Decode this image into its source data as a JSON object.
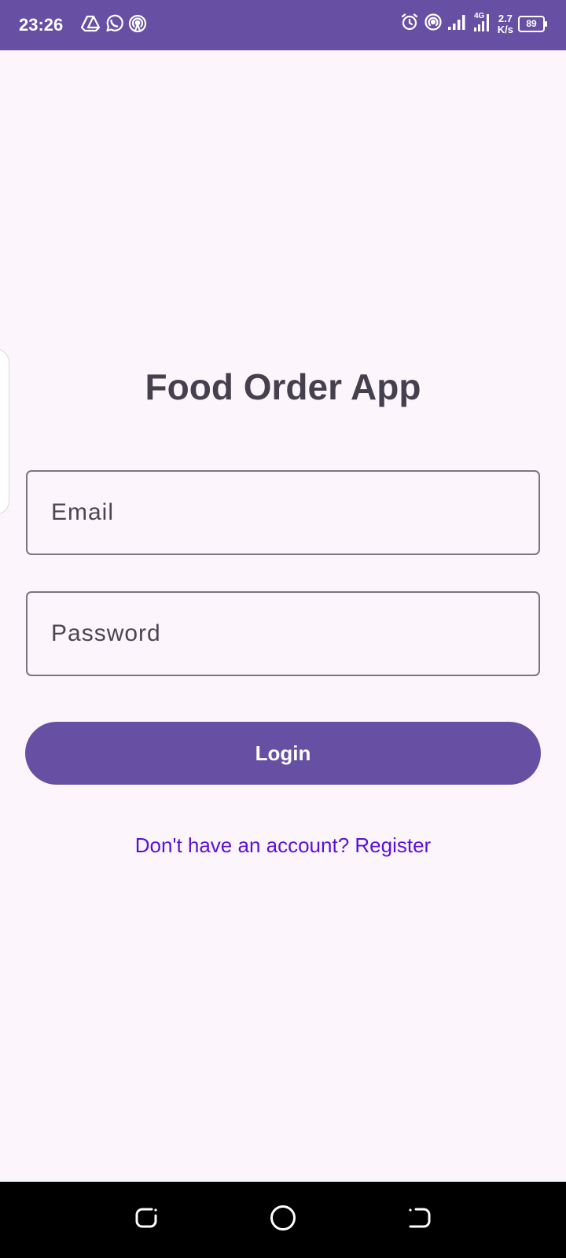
{
  "status_bar": {
    "time": "23:26",
    "network_type": "4G",
    "net_speed_value": "2.7",
    "net_speed_unit": "K/s",
    "battery_level": "89",
    "left_icons": [
      "drive-icon",
      "whatsapp-icon",
      "hotspot-icon"
    ],
    "right_icons": [
      "alarm-icon",
      "hotspot-icon",
      "signal-icon",
      "signal-4g-icon"
    ],
    "background_color": "#6750A4"
  },
  "login_screen": {
    "title": "Food Order App",
    "email_placeholder": "Email",
    "password_placeholder": "Password",
    "login_button_label": "Login",
    "register_prompt": "Don't have an account? Register",
    "accent_color": "#6750A4",
    "link_color": "#5B10D6",
    "background_color": "#FCF6FC"
  },
  "nav_bar": {
    "buttons": [
      "recents-icon",
      "home-icon",
      "back-icon"
    ]
  }
}
